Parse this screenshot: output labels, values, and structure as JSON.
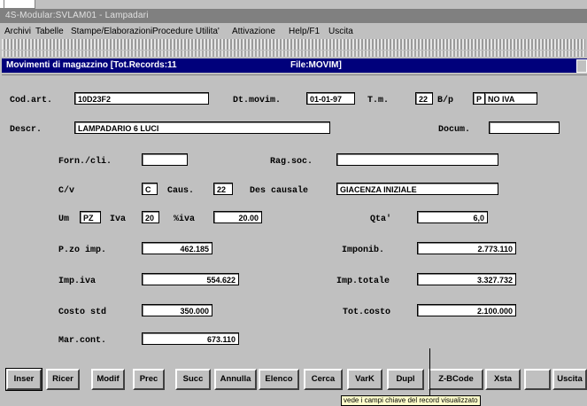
{
  "app": {
    "title": "4S-Modular:SVLAM01 - Lampadari"
  },
  "menu": [
    "Archivi",
    "Tabelle",
    "Stampe/Elaborazioni",
    "Procedure Utilita'",
    "Attivazione",
    "Help/F1",
    "Uscita"
  ],
  "window": {
    "title": "Movimenti di magazzino [Tot.Records:11",
    "file": "File:MOVIM]"
  },
  "form": {
    "cod_art": {
      "label": "Cod.art.",
      "value": "10D23F2"
    },
    "dt_movim": {
      "label": "Dt.movim.",
      "value": "01-01-97"
    },
    "tm": {
      "label": "T.m.",
      "value": "22"
    },
    "bp": {
      "label": "B/p",
      "value": "P"
    },
    "no_iva": {
      "value": "NO IVA"
    },
    "descr": {
      "label": "Descr.",
      "value": "LAMPADARIO 6 LUCI"
    },
    "docum": {
      "label": "Docum.",
      "value": ""
    },
    "forn_cli": {
      "label": "Forn./cli.",
      "value": ""
    },
    "rag_soc": {
      "label": "Rag.soc.",
      "value": ""
    },
    "cv": {
      "label": "C/v",
      "value": "C"
    },
    "caus": {
      "label": "Caus.",
      "value": "22"
    },
    "des_causale": {
      "label": "Des causale",
      "value": "GIACENZA INIZIALE"
    },
    "um": {
      "label": "Um",
      "value": "PZ"
    },
    "iva": {
      "label": "Iva",
      "value": "20"
    },
    "perc_iva": {
      "label": "%iva",
      "value": "20.00"
    },
    "qta": {
      "label": "Qta'",
      "value": "6,0"
    },
    "p_zo_imp": {
      "label": "P.zo imp.",
      "value": "462.185"
    },
    "imponib": {
      "label": "Imponib.",
      "value": "2.773.110"
    },
    "imp_iva": {
      "label": "Imp.iva",
      "value": "554.622"
    },
    "imp_totale": {
      "label": "Imp.totale",
      "value": "3.327.732"
    },
    "costo_std": {
      "label": "Costo std",
      "value": "350.000"
    },
    "tot_costo": {
      "label": "Tot.costo",
      "value": "2.100.000"
    },
    "mar_cont": {
      "label": "Mar.cont.",
      "value": "673.110"
    }
  },
  "buttons": [
    "Inser",
    "Ricer",
    "Modif",
    "Prec",
    "Succ",
    "Annulla",
    "Elenco",
    "Cerca",
    "VarK",
    "Dupl",
    "Z-BCode",
    "Xsta",
    "",
    "Uscita"
  ],
  "tooltip": "vede i campi chiave del record visualizzato"
}
